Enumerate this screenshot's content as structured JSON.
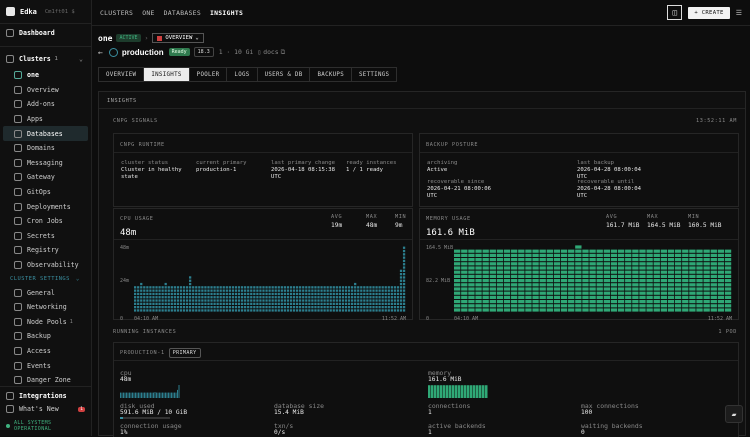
{
  "sidebar": {
    "org": "Edka",
    "org_sub": "Cm1ft01 $",
    "dashboard": "Dashboard",
    "clusters": "Clusters",
    "clusters_count": "1",
    "cluster_name": "one",
    "items": [
      "Overview",
      "Add-ons",
      "Apps",
      "Databases",
      "Domains",
      "Messaging",
      "Gateway",
      "GitOps",
      "Deployments",
      "Cron Jobs",
      "Secrets",
      "Registry",
      "Observability"
    ],
    "settings_label": "CLUSTER SETTINGS",
    "settings": [
      "General",
      "Networking",
      "Node Pools",
      "Backup",
      "Access",
      "Events",
      "Danger Zone"
    ],
    "node_pools_count": "1",
    "integrations": "Integrations",
    "whats_new": "What's New",
    "whats_new_badge": "1",
    "status": "ALL SYSTEMS OPERATIONAL"
  },
  "topbar": {
    "crumbs": [
      "CLUSTERS",
      "ONE",
      "DATABASES",
      "INSIGHTS"
    ],
    "create": "+ CREATE"
  },
  "header": {
    "cluster": "one",
    "cluster_status": "ACTIVE",
    "overview": "OVERVIEW",
    "db_name": "production",
    "db_status": "Ready",
    "version": "18.3",
    "meta": "1 · 10 Gi",
    "docs": "docs"
  },
  "tabs": [
    "OVERVIEW",
    "INSIGHTS",
    "POOLER",
    "LOGS",
    "USERS & DB",
    "BACKUPS",
    "SETTINGS"
  ],
  "insights": {
    "title": "INSIGHTS",
    "section": "CNPG SIGNALS",
    "time": "13:52:11 AM",
    "runtime": {
      "title": "CNPG RUNTIME",
      "cols": [
        {
          "label": "cluster status",
          "value": "Cluster in healthy state"
        },
        {
          "label": "current primary",
          "value": "production-1"
        },
        {
          "label": "last primary change",
          "value": "2026-04-18 08:15:38 UTC"
        },
        {
          "label": "ready instances",
          "value": "1 / 1 ready"
        }
      ]
    },
    "backup": {
      "title": "BACKUP POSTURE",
      "cols": [
        {
          "label": "archiving",
          "value": "Active"
        },
        {
          "label": "last backup",
          "value": "2026-04-28 08:00:04 UTC"
        },
        {
          "label": "recoverable since",
          "value": "2026-04-21 08:00:06 UTC"
        },
        {
          "label": "recoverable until",
          "value": "2026-04-28 08:00:04 UTC"
        }
      ]
    },
    "cpu": {
      "title": "CPU USAGE",
      "value": "48m",
      "avg_l": "AVG",
      "avg": "19m",
      "max_l": "MAX",
      "max": "48m",
      "min_l": "MIN",
      "min": "9m",
      "y_top": "48m",
      "y_mid": "24m",
      "y_zero": "0",
      "x_start": "04:10 AM",
      "x_end": "11:52 AM"
    },
    "memory": {
      "title": "MEMORY USAGE",
      "value": "161.6 MiB",
      "avg_l": "AVG",
      "avg": "161.7 MiB",
      "max_l": "MAX",
      "max": "164.5 MiB",
      "min_l": "MIN",
      "min": "160.5 MiB",
      "y_top": "164.5 MiB",
      "y_mid": "82.2 MiB",
      "y_zero": "0",
      "x_start": "04:10 AM",
      "x_end": "11:52 AM"
    },
    "running": {
      "title": "RUNNING INSTANCES",
      "count": "1 POD",
      "pod": "PRODUCTION-1",
      "role": "PRIMARY",
      "cpu_l": "cpu",
      "cpu": "48m",
      "mem_l": "memory",
      "mem": "161.6 MiB",
      "disk_l": "disk used",
      "disk": "591.6 MiB / 10 GiB",
      "dbsize_l": "database size",
      "dbsize": "15.4 MiB",
      "conn_l": "connections",
      "conn": "1",
      "maxconn_l": "max connections",
      "maxconn": "100",
      "connuse_l": "connection usage",
      "connuse": "1%",
      "tps_l": "txn/s",
      "tps": "0/s",
      "active_l": "active backends",
      "active": "1",
      "wait_l": "waiting backends",
      "wait": "0"
    }
  },
  "chart_data": [
    {
      "type": "bar",
      "title": "CPU USAGE",
      "ylabel": "",
      "ylim": [
        0,
        48
      ],
      "values": [
        20,
        20,
        22,
        20,
        20,
        20,
        20,
        20,
        20,
        20,
        22,
        20,
        20,
        20,
        20,
        20,
        20,
        20,
        26,
        20,
        20,
        20,
        20,
        20,
        20,
        20,
        20,
        20,
        20,
        20,
        20,
        20,
        20,
        20,
        20,
        20,
        20,
        20,
        20,
        20,
        20,
        20,
        20,
        20,
        20,
        20,
        20,
        20,
        20,
        20,
        20,
        20,
        20,
        20,
        20,
        20,
        20,
        20,
        20,
        20,
        20,
        20,
        20,
        20,
        20,
        20,
        20,
        20,
        20,
        20,
        20,
        20,
        22,
        20,
        20,
        20,
        20,
        20,
        20,
        20,
        20,
        20,
        20,
        20,
        20,
        20,
        20,
        30,
        48
      ]
    },
    {
      "type": "bar",
      "title": "MEMORY USAGE",
      "ylim": [
        0,
        164.5
      ],
      "values": [
        161.7,
        161.7,
        161.7,
        161.7,
        161.7,
        161.7,
        161.7,
        161.7,
        161.7,
        161.7,
        161.7,
        161.7,
        161.7,
        161.7,
        161.7,
        161.7,
        161.7,
        164.5,
        161.7,
        161.7,
        161.7,
        161.7,
        161.7,
        161.7,
        161.7,
        161.7,
        161.7,
        161.7,
        161.7,
        161.7,
        161.7,
        161.7,
        161.7,
        161.7,
        161.7,
        161.7,
        161.7,
        161.7,
        161.7
      ]
    }
  ],
  "colors": {
    "accent": "#3a8fa0",
    "green": "#3fb27f",
    "ready": "#2f7a4e",
    "red": "#d04040"
  }
}
